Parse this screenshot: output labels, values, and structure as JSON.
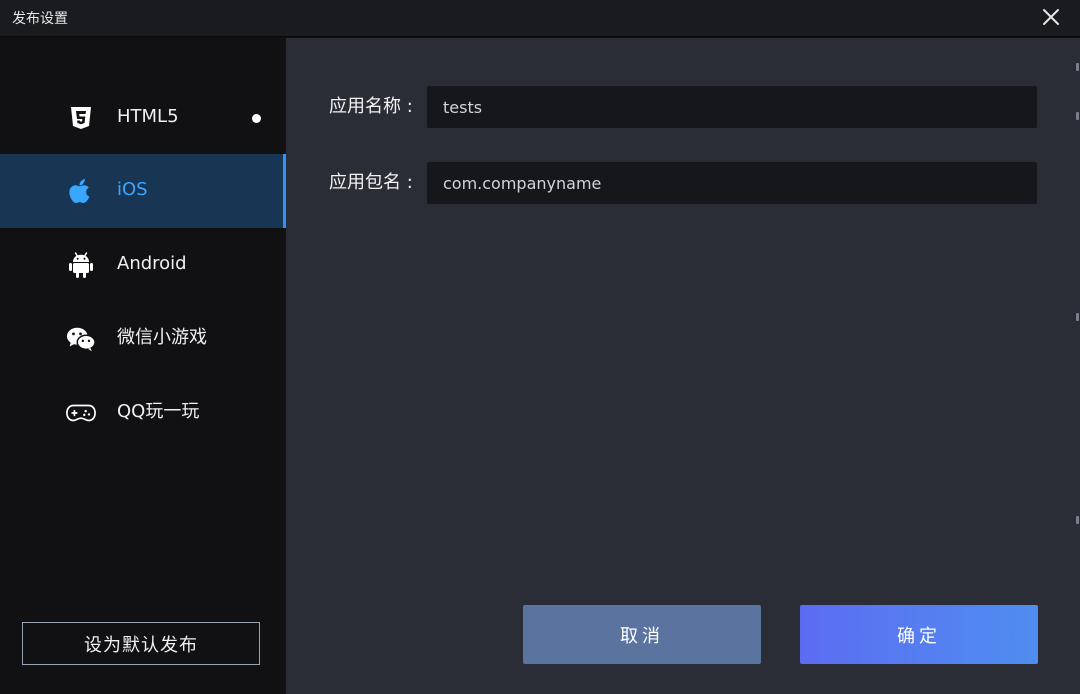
{
  "window": {
    "title": "发布设置",
    "close_icon": "close-icon"
  },
  "sidebar": {
    "items": [
      {
        "id": "html5",
        "label": "HTML5",
        "icon": "html5-icon",
        "active": false,
        "has_dot": true
      },
      {
        "id": "ios",
        "label": "iOS",
        "icon": "apple-icon",
        "active": true
      },
      {
        "id": "android",
        "label": "Android",
        "icon": "android-icon",
        "active": false
      },
      {
        "id": "wechat",
        "label": "微信小游戏",
        "icon": "wechat-icon",
        "active": false
      },
      {
        "id": "qq",
        "label": "QQ玩一玩",
        "icon": "gamepad-icon",
        "active": false
      }
    ],
    "default_button_label": "设为默认发布"
  },
  "form": {
    "app_name_label": "应用名称 :",
    "app_name_value": "tests",
    "package_label": "应用包名 :",
    "package_value": "com.companyname"
  },
  "actions": {
    "cancel_label": "取消",
    "ok_label": "确定"
  },
  "colors": {
    "accent": "#2d93ff",
    "active_bg": "#183553",
    "cancel_bg": "#5b739f",
    "ok_gradient_start": "#5c6cf2",
    "ok_gradient_end": "#4f8ef0"
  }
}
